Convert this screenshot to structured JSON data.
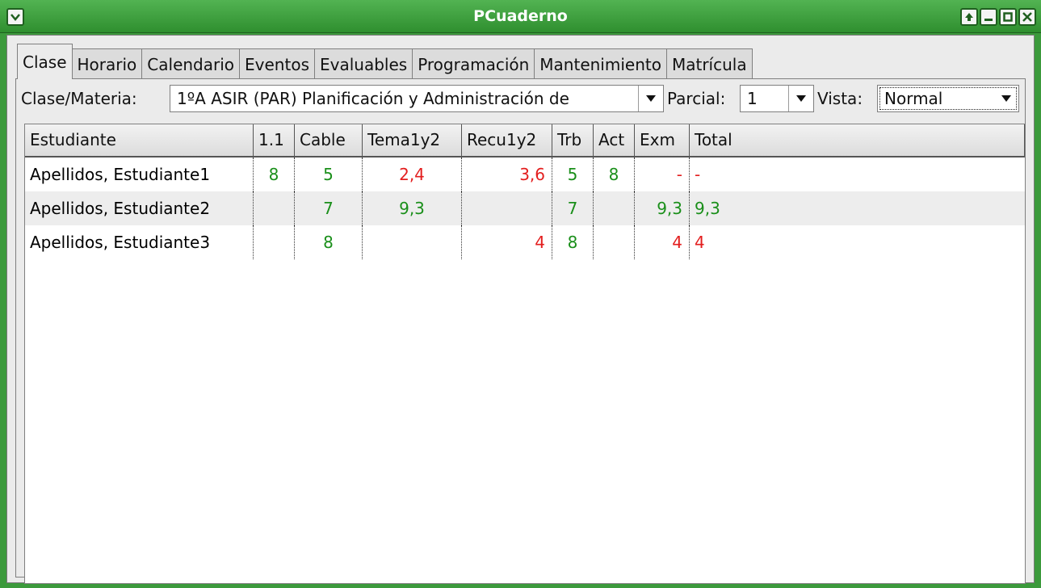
{
  "window": {
    "title": "PCuaderno",
    "menu_icon": "chevron-down-icon",
    "controls": [
      "arrow-up-icon",
      "minimize-icon",
      "maximize-icon",
      "close-icon"
    ]
  },
  "tabs": [
    "Clase",
    "Horario",
    "Calendario",
    "Eventos",
    "Evaluables",
    "Programación",
    "Mantenimiento",
    "Matrícula"
  ],
  "toolbar": {
    "clase_label": "Clase/Materia:",
    "clase_value": "1ºA ASIR (PAR) Planificación y Administración de",
    "parcial_label": "Parcial:",
    "parcial_value": "1",
    "vista_label": "Vista:",
    "vista_value": "Normal"
  },
  "table": {
    "columns": [
      "Estudiante",
      "1.1",
      "Cable",
      "Tema1y2",
      "Recu1y2",
      "Trb",
      "Act",
      "Exm",
      "Total"
    ],
    "rows": [
      [
        "Apellidos, Estudiante1",
        "8",
        "5",
        "2,4",
        "3,6",
        "5",
        "8",
        "-",
        "-"
      ],
      [
        "Apellidos, Estudiante2",
        "",
        "7",
        "9,3",
        "",
        "7",
        "",
        "9,3",
        "9,3"
      ],
      [
        "Apellidos, Estudiante3",
        "",
        "8",
        "",
        "4",
        "8",
        "",
        "4",
        "4"
      ]
    ],
    "cell_colors": [
      [
        "",
        "green",
        "green",
        "red",
        "red",
        "green",
        "green",
        "red",
        "red"
      ],
      [
        "",
        "",
        "green",
        "green",
        "",
        "green",
        "",
        "green",
        "green"
      ],
      [
        "",
        "",
        "green",
        "",
        "red",
        "green",
        "",
        "red",
        "red"
      ]
    ]
  },
  "colors": {
    "titlebar": "#3c9a3c",
    "pass": "#1a8f1a",
    "fail": "#e31e1e"
  }
}
